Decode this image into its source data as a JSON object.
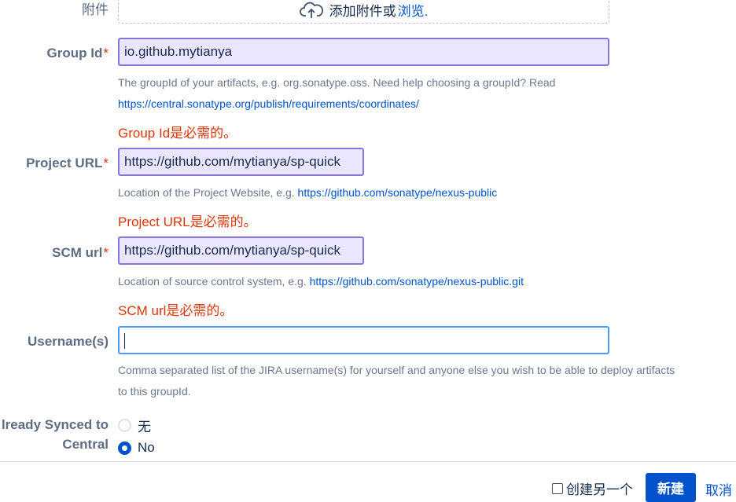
{
  "attachment": {
    "label": "附件",
    "text": "添加附件或",
    "browse": "浏览."
  },
  "group_id": {
    "label": "Group Id",
    "required_mark": "*",
    "value": "io.github.mytianya",
    "help_text": "The groupId of your artifacts, e.g. org.sonatype.oss. Need help choosing a groupId? Read",
    "help_link": "https://central.sonatype.org/publish/requirements/coordinates/",
    "error": "Group Id是必需的。"
  },
  "project_url": {
    "label": "Project URL",
    "required_mark": "*",
    "value": "https://github.com/mytianya/sp-quick",
    "help_text": "Location of the Project Website, e.g.",
    "help_link": "https://github.com/sonatype/nexus-public",
    "error": "Project URL是必需的。"
  },
  "scm_url": {
    "label": "SCM url",
    "required_mark": "*",
    "value": "https://github.com/mytianya/sp-quick",
    "help_text": "Location of source control system, e.g.",
    "help_link": "https://github.com/sonatype/nexus-public.git",
    "error": "SCM url是必需的。"
  },
  "username": {
    "label": "Username(s)",
    "value": "",
    "help_line1": "Comma separated list of the JIRA username(s) for yourself and anyone else you wish to be able to deploy artifacts",
    "help_line2": "to this groupId."
  },
  "synced": {
    "label_line1": "lready Synced to",
    "label_line2": "Central",
    "options": [
      {
        "label": "无",
        "selected": false
      },
      {
        "label": "No",
        "selected": true
      }
    ]
  },
  "footer": {
    "create_another": "创建另一个",
    "create_another_checked": false,
    "create_button": "新建",
    "cancel_link": "取消"
  },
  "colors": {
    "accent": "#0052cc",
    "error": "#de350b",
    "invalid_border": "#8777d9",
    "invalid_fill": "#eae6ff",
    "focus_border": "#4c9aff"
  }
}
